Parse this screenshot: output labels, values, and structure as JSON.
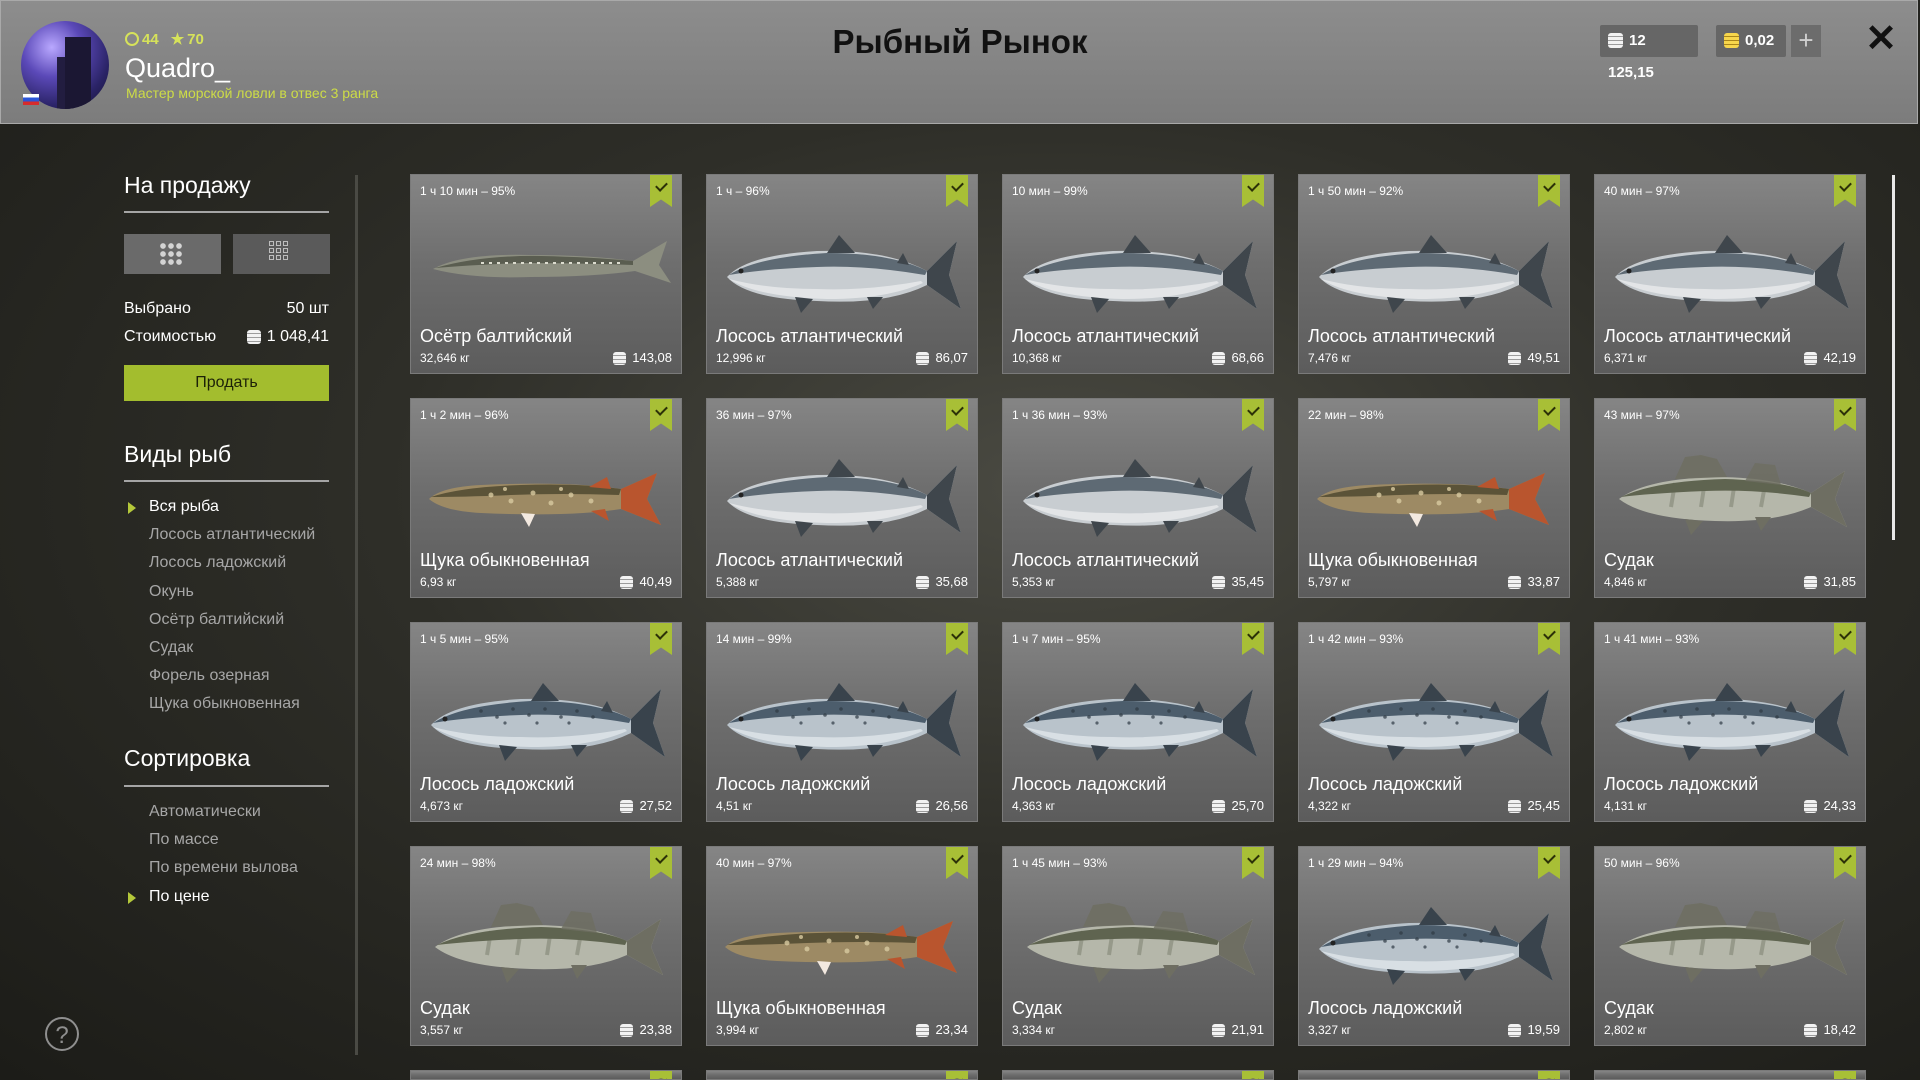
{
  "header": {
    "title": "Рыбный Рынок",
    "player": {
      "level": "44",
      "rank": "70",
      "name": "Quadro_",
      "title": "Мастер морской ловли в отвес 3 ранга"
    },
    "currency_silver": "12 125,15",
    "currency_gold": "0,02"
  },
  "sidebar": {
    "sale_heading": "На продажу",
    "selected_label": "Выбрано",
    "selected_value": "50 шт",
    "cost_label": "Стоимостью",
    "cost_value": "1 048,41",
    "sell_button": "Продать",
    "species_heading": "Виды рыб",
    "species": [
      {
        "label": "Вся рыба",
        "active": true
      },
      {
        "label": "Лосось атлантический",
        "active": false
      },
      {
        "label": "Лосось ладожский",
        "active": false
      },
      {
        "label": "Окунь",
        "active": false
      },
      {
        "label": "Осётр балтийский",
        "active": false
      },
      {
        "label": "Судак",
        "active": false
      },
      {
        "label": "Форель озерная",
        "active": false
      },
      {
        "label": "Щука обыкновенная",
        "active": false
      }
    ],
    "sort_heading": "Сортировка",
    "sort_options": [
      {
        "label": "Автоматически",
        "active": false
      },
      {
        "label": "По массе",
        "active": false
      },
      {
        "label": "По времени вылова",
        "active": false
      },
      {
        "label": "По цене",
        "active": true
      }
    ]
  },
  "colors": {
    "accent": "#a8bf36",
    "header_bg": "#868686",
    "title_text": "#111111"
  },
  "fish_cards": [
    {
      "meta": "1 ч 10 мин – 95%",
      "name": "Осётр балтийский",
      "weight": "32,646 кг",
      "price": "143,08",
      "species": "sturgeon"
    },
    {
      "meta": "1 ч – 96%",
      "name": "Лосось атлантический",
      "weight": "12,996 кг",
      "price": "86,07",
      "species": "atlantic"
    },
    {
      "meta": "10 мин – 99%",
      "name": "Лосось атлантический",
      "weight": "10,368 кг",
      "price": "68,66",
      "species": "atlantic"
    },
    {
      "meta": "1 ч 50 мин – 92%",
      "name": "Лосось атлантический",
      "weight": "7,476 кг",
      "price": "49,51",
      "species": "atlantic"
    },
    {
      "meta": "40 мин – 97%",
      "name": "Лосось атлантический",
      "weight": "6,371 кг",
      "price": "42,19",
      "species": "atlantic"
    },
    {
      "meta": "1 ч 2 мин – 96%",
      "name": "Щука обыкновенная",
      "weight": "6,93 кг",
      "price": "40,49",
      "species": "pike"
    },
    {
      "meta": "36 мин – 97%",
      "name": "Лосось атлантический",
      "weight": "5,388 кг",
      "price": "35,68",
      "species": "atlantic"
    },
    {
      "meta": "1 ч 36 мин – 93%",
      "name": "Лосось атлантический",
      "weight": "5,353 кг",
      "price": "35,45",
      "species": "atlantic"
    },
    {
      "meta": "22 мин – 98%",
      "name": "Щука обыкновенная",
      "weight": "5,797 кг",
      "price": "33,87",
      "species": "pike"
    },
    {
      "meta": "43 мин – 97%",
      "name": "Судак",
      "weight": "4,846 кг",
      "price": "31,85",
      "species": "zander"
    },
    {
      "meta": "1 ч 5 мин – 95%",
      "name": "Лосось ладожский",
      "weight": "4,673 кг",
      "price": "27,52",
      "species": "ladoga"
    },
    {
      "meta": "14 мин – 99%",
      "name": "Лосось ладожский",
      "weight": "4,51 кг",
      "price": "26,56",
      "species": "ladoga"
    },
    {
      "meta": "1 ч 7 мин – 95%",
      "name": "Лосось ладожский",
      "weight": "4,363 кг",
      "price": "25,70",
      "species": "ladoga"
    },
    {
      "meta": "1 ч 42 мин – 93%",
      "name": "Лосось ладожский",
      "weight": "4,322 кг",
      "price": "25,45",
      "species": "ladoga"
    },
    {
      "meta": "1 ч 41 мин – 93%",
      "name": "Лосось ладожский",
      "weight": "4,131 кг",
      "price": "24,33",
      "species": "ladoga"
    },
    {
      "meta": "24 мин – 98%",
      "name": "Судак",
      "weight": "3,557 кг",
      "price": "23,38",
      "species": "zander"
    },
    {
      "meta": "40 мин – 97%",
      "name": "Щука обыкновенная",
      "weight": "3,994 кг",
      "price": "23,34",
      "species": "pike"
    },
    {
      "meta": "1 ч 45 мин – 93%",
      "name": "Судак",
      "weight": "3,334 кг",
      "price": "21,91",
      "species": "zander"
    },
    {
      "meta": "1 ч 29 мин – 94%",
      "name": "Лосось ладожский",
      "weight": "3,327 кг",
      "price": "19,59",
      "species": "ladoga"
    },
    {
      "meta": "50 мин – 96%",
      "name": "Судак",
      "weight": "2,802 кг",
      "price": "18,42",
      "species": "zander"
    }
  ]
}
